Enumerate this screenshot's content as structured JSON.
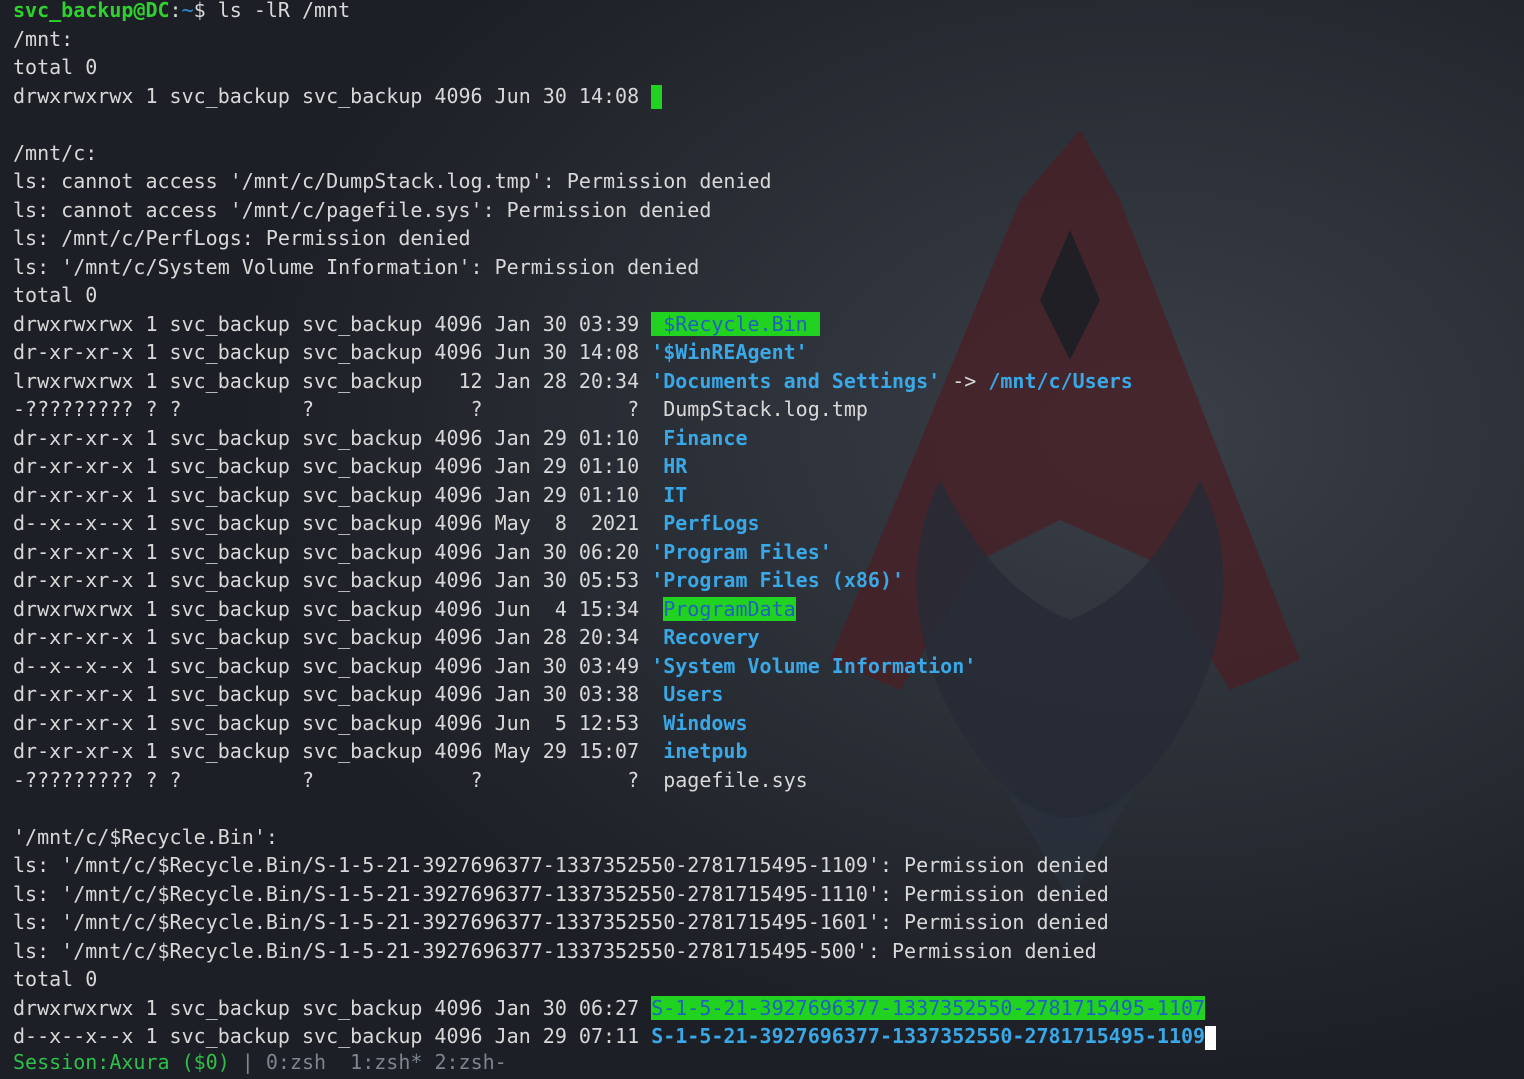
{
  "prompt": {
    "user_host": "svc_backup@DC",
    "path": "~",
    "command": "$ ls -lR /mnt"
  },
  "lines": {
    "l1": "/mnt:",
    "l2": "total 0",
    "l3": "drwxrwxrwx 1 svc_backup svc_backup 4096 Jun 30 14:08 ",
    "l5": "/mnt/c:",
    "l6": "ls: cannot access '/mnt/c/DumpStack.log.tmp': Permission denied",
    "l7": "ls: cannot access '/mnt/c/pagefile.sys': Permission denied",
    "l8": "ls: /mnt/c/PerfLogs: Permission denied",
    "l9": "ls: '/mnt/c/System Volume Information': Permission denied",
    "l10": "total 0",
    "r11": "drwxrwxrwx 1 svc_backup svc_backup 4096 Jan 30 03:39 ",
    "n11": " $Recycle.Bin ",
    "r12": "dr-xr-xr-x 1 svc_backup svc_backup 4096 Jun 30 14:08 ",
    "n12": "'$WinREAgent'",
    "r13": "lrwxrwxrwx 1 svc_backup svc_backup   12 Jan 28 20:34 ",
    "n13": "'Documents and Settings'",
    "a13": " -> ",
    "t13": "/mnt/c/Users",
    "r14": "-????????? ? ?          ?             ?            ?  DumpStack.log.tmp",
    "r15": "dr-xr-xr-x 1 svc_backup svc_backup 4096 Jan 29 01:10  ",
    "n15": "Finance",
    "r16": "dr-xr-xr-x 1 svc_backup svc_backup 4096 Jan 29 01:10  ",
    "n16": "HR",
    "r17": "dr-xr-xr-x 1 svc_backup svc_backup 4096 Jan 29 01:10  ",
    "n17": "IT",
    "r18": "d--x--x--x 1 svc_backup svc_backup 4096 May  8  2021  ",
    "n18": "PerfLogs",
    "r19": "dr-xr-xr-x 1 svc_backup svc_backup 4096 Jan 30 06:20 ",
    "n19": "'Program Files'",
    "r20": "dr-xr-xr-x 1 svc_backup svc_backup 4096 Jan 30 05:53 ",
    "n20": "'Program Files (x86)'",
    "r21": "drwxrwxrwx 1 svc_backup svc_backup 4096 Jun  4 15:34  ",
    "n21": "ProgramData",
    "r22": "dr-xr-xr-x 1 svc_backup svc_backup 4096 Jan 28 20:34  ",
    "n22": "Recovery",
    "r23": "d--x--x--x 1 svc_backup svc_backup 4096 Jan 30 03:49 ",
    "n23": "'System Volume Information'",
    "r24": "dr-xr-xr-x 1 svc_backup svc_backup 4096 Jan 30 03:38  ",
    "n24": "Users",
    "r25": "dr-xr-xr-x 1 svc_backup svc_backup 4096 Jun  5 12:53  ",
    "n25": "Windows",
    "r26": "dr-xr-xr-x 1 svc_backup svc_backup 4096 May 29 15:07  ",
    "n26": "inetpub",
    "r27": "-????????? ? ?          ?             ?            ?  pagefile.sys",
    "l29": "'/mnt/c/$Recycle.Bin':",
    "l30": "ls: '/mnt/c/$Recycle.Bin/S-1-5-21-3927696377-1337352550-2781715495-1109': Permission denied",
    "l31": "ls: '/mnt/c/$Recycle.Bin/S-1-5-21-3927696377-1337352550-2781715495-1110': Permission denied",
    "l32": "ls: '/mnt/c/$Recycle.Bin/S-1-5-21-3927696377-1337352550-2781715495-1601': Permission denied",
    "l33": "ls: '/mnt/c/$Recycle.Bin/S-1-5-21-3927696377-1337352550-2781715495-500': Permission denied",
    "l34": "total 0",
    "r35": "drwxrwxrwx 1 svc_backup svc_backup 4096 Jan 30 06:27 ",
    "n35": "S-1-5-21-3927696377-1337352550-2781715495-1107",
    "r36": "d--x--x--x 1 svc_backup svc_backup 4096 Jan 29 07:11 ",
    "n36": "S-1-5-21-3927696377-1337352550-2781715495-1109"
  },
  "status": {
    "session": "Session:Axura ($0)",
    "windows": " | 0:zsh  1:zsh* 2:zsh-"
  },
  "colors": {
    "green": "#2ed12e",
    "blue": "#2f8fdc",
    "highlight": "#21d221",
    "background": "#1c1f25",
    "emblem_red": "#4a1f24"
  },
  "icons": {
    "background": "assassin-creed-emblem-icon"
  }
}
